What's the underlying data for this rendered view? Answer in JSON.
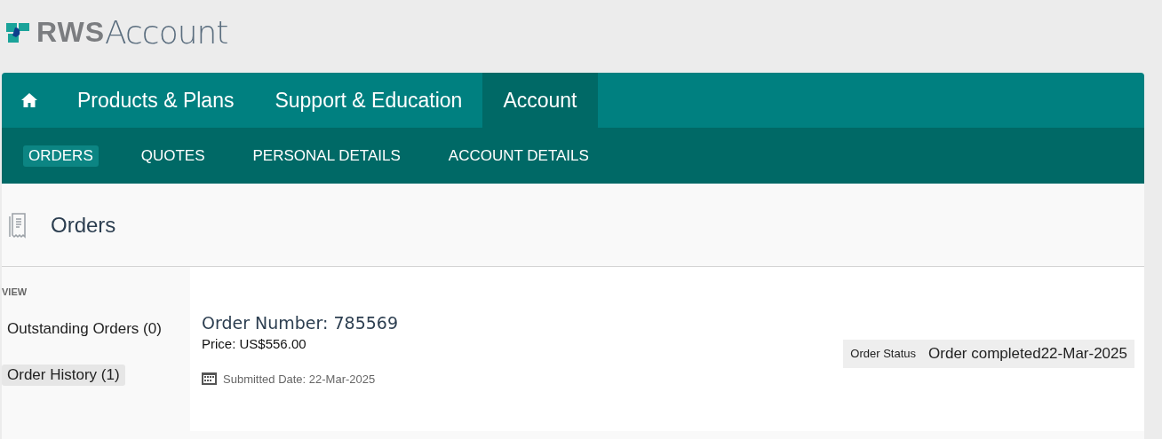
{
  "logo": {
    "brand": "RWS",
    "product": "Account"
  },
  "main_nav": [
    {
      "kind": "home",
      "selected": false
    },
    {
      "kind": "link",
      "label": "Products & Plans",
      "selected": false
    },
    {
      "kind": "link",
      "label": "Support & Education",
      "selected": false
    },
    {
      "kind": "link",
      "label": "Account",
      "selected": true
    }
  ],
  "sub_nav": [
    {
      "label": "ORDERS",
      "selected": true
    },
    {
      "label": "QUOTES",
      "selected": false
    },
    {
      "label": "PERSONAL DETAILS",
      "selected": false
    },
    {
      "label": "ACCOUNT DETAILS",
      "selected": false
    }
  ],
  "page_title": "Orders",
  "sidebar": {
    "heading": "VIEW",
    "items": [
      {
        "label": "Outstanding Orders (0)",
        "selected": false
      },
      {
        "label": "Order History (1)",
        "selected": true
      }
    ]
  },
  "order": {
    "number": "Order Number: 785569",
    "price": "Price: US$556.00",
    "submitted": "Submitted Date: 22-Mar-2025",
    "status_label": "Order Status",
    "status": "Order completed22-Mar-2025"
  }
}
